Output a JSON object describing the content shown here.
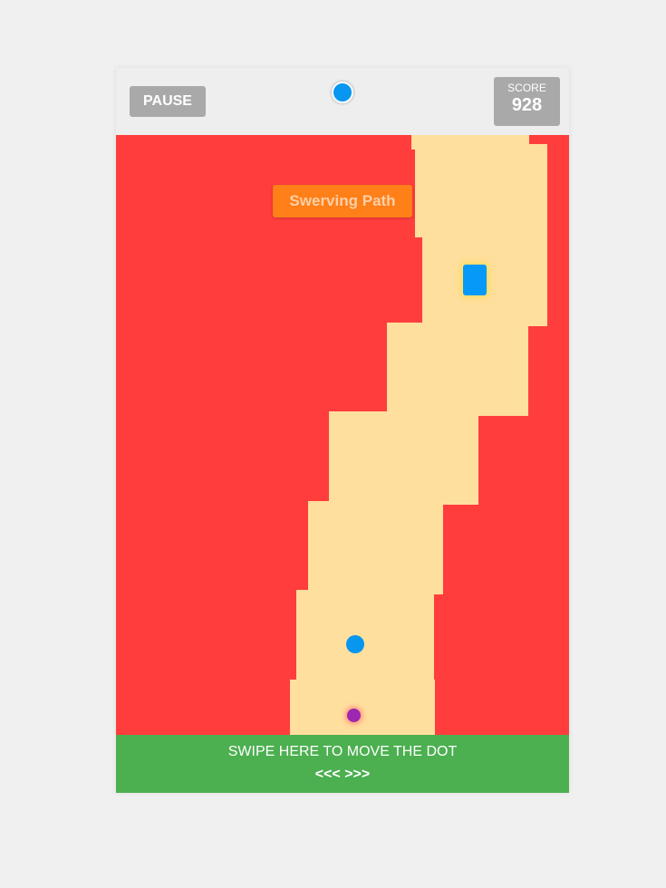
{
  "hud": {
    "pause_label": "PAUSE",
    "score_label": "SCORE",
    "score_value": "928"
  },
  "banner": {
    "text": "Swerving Path"
  },
  "swipe": {
    "instruction": "SWIPE HERE TO MOVE THE DOT",
    "arrows": "<<< >>>"
  },
  "colors": {
    "background": "#ff3d3d",
    "path": "#ffdf9e",
    "topbar": "#eeeeee",
    "button": "#a9a9a9",
    "banner": "#ff7f18",
    "obstacle": "#0799f7",
    "ball": "#0796f0",
    "player": "#9c27b0",
    "swipe_area": "#4caf50"
  }
}
